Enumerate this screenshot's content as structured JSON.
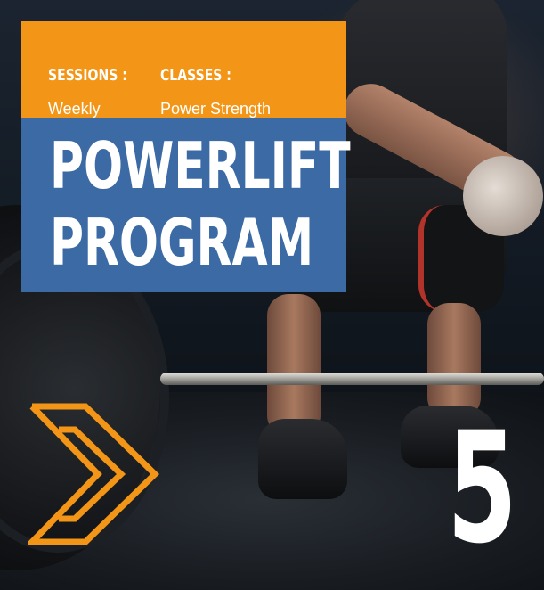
{
  "info": {
    "sessions_label": "SESSIONS :",
    "sessions_value": "Weekly",
    "classes_label": "CLASSES :",
    "classes_value": "Power Strength"
  },
  "title": {
    "line1": "POWERLIFT",
    "line2": "PROGRAM"
  },
  "badge_number": "5",
  "decor": {
    "arrow_icon": "double-chevron-right-icon",
    "photo": "athlete-chalking-hands-above-barbell"
  },
  "colors": {
    "accent_orange": "#f39617",
    "panel_blue": "#3b6aa4",
    "text": "#ffffff"
  }
}
